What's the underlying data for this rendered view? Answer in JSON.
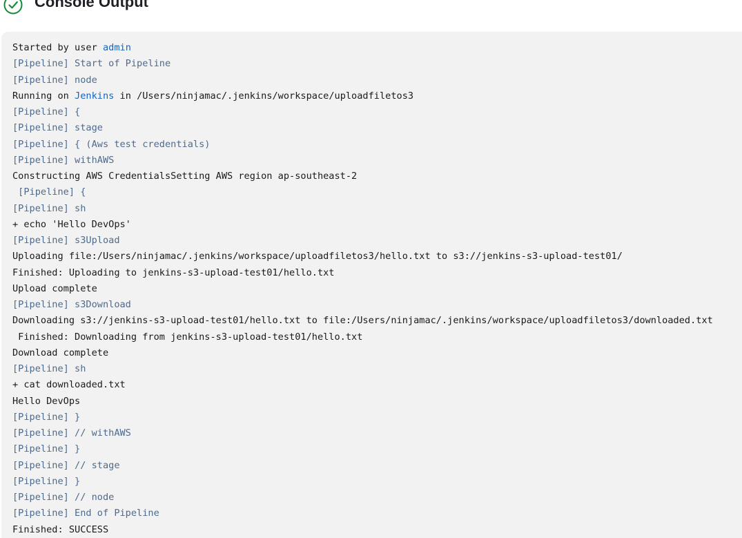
{
  "header": {
    "title": "Console Output",
    "status_icon": "check-circle-icon",
    "status_color": "#138a36"
  },
  "colors": {
    "console_bg": "#f2f2f2",
    "pipeline_text": "#4f6a8c",
    "link": "#1565c0",
    "text": "#1a1a1a"
  },
  "console": {
    "lines": [
      {
        "pre": "Started by user ",
        "link": "admin",
        "post": "",
        "type": "normal"
      },
      {
        "text": "[Pipeline] Start of Pipeline",
        "type": "pipeline"
      },
      {
        "text": "[Pipeline] node",
        "type": "pipeline"
      },
      {
        "pre": "Running on ",
        "link": "Jenkins",
        "post": " in /Users/ninjamac/.jenkins/workspace/uploadfiletos3",
        "type": "normal"
      },
      {
        "text": "[Pipeline] {",
        "type": "pipeline"
      },
      {
        "text": "[Pipeline] stage",
        "type": "pipeline"
      },
      {
        "text": "[Pipeline] { (Aws test credentials)",
        "type": "pipeline"
      },
      {
        "text": "[Pipeline] withAWS",
        "type": "pipeline"
      },
      {
        "text": "Constructing AWS CredentialsSetting AWS region ap-southeast-2",
        "type": "normal"
      },
      {
        "text": " [Pipeline] {",
        "type": "pipeline"
      },
      {
        "text": "[Pipeline] sh",
        "type": "pipeline"
      },
      {
        "text": "+ echo 'Hello DevOps'",
        "type": "normal"
      },
      {
        "text": "[Pipeline] s3Upload",
        "type": "pipeline"
      },
      {
        "text": "Uploading file:/Users/ninjamac/.jenkins/workspace/uploadfiletos3/hello.txt to s3://jenkins-s3-upload-test01/",
        "type": "normal"
      },
      {
        "text": "Finished: Uploading to jenkins-s3-upload-test01/hello.txt",
        "type": "normal"
      },
      {
        "text": "Upload complete",
        "type": "normal"
      },
      {
        "text": "[Pipeline] s3Download",
        "type": "pipeline"
      },
      {
        "text": "Downloading s3://jenkins-s3-upload-test01/hello.txt to file:/Users/ninjamac/.jenkins/workspace/uploadfiletos3/downloaded.txt",
        "type": "normal"
      },
      {
        "text": " Finished: Downloading from jenkins-s3-upload-test01/hello.txt",
        "type": "normal"
      },
      {
        "text": "Download complete",
        "type": "normal"
      },
      {
        "text": "[Pipeline] sh",
        "type": "pipeline"
      },
      {
        "text": "+ cat downloaded.txt",
        "type": "normal"
      },
      {
        "text": "Hello DevOps",
        "type": "normal"
      },
      {
        "text": "[Pipeline] }",
        "type": "pipeline"
      },
      {
        "text": "[Pipeline] // withAWS",
        "type": "pipeline"
      },
      {
        "text": "[Pipeline] }",
        "type": "pipeline"
      },
      {
        "text": "[Pipeline] // stage",
        "type": "pipeline"
      },
      {
        "text": "[Pipeline] }",
        "type": "pipeline"
      },
      {
        "text": "[Pipeline] // node",
        "type": "pipeline"
      },
      {
        "text": "[Pipeline] End of Pipeline",
        "type": "pipeline"
      },
      {
        "text": "Finished: SUCCESS",
        "type": "normal"
      }
    ]
  }
}
